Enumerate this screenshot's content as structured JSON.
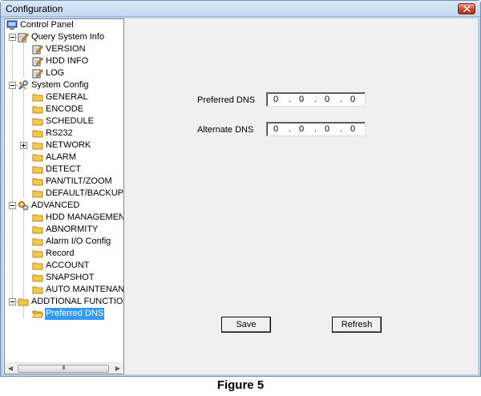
{
  "window": {
    "title": "Configuration"
  },
  "tree": {
    "items": [
      {
        "label": "Control Panel"
      },
      {
        "label": "Query System Info"
      },
      {
        "label": "VERSION"
      },
      {
        "label": "HDD INFO"
      },
      {
        "label": "LOG"
      },
      {
        "label": "System Config"
      },
      {
        "label": "GENERAL"
      },
      {
        "label": "ENCODE"
      },
      {
        "label": "SCHEDULE"
      },
      {
        "label": "RS232"
      },
      {
        "label": "NETWORK"
      },
      {
        "label": "ALARM"
      },
      {
        "label": "DETECT"
      },
      {
        "label": "PAN/TILT/ZOOM"
      },
      {
        "label": "DEFAULT/BACKUP"
      },
      {
        "label": "ADVANCED"
      },
      {
        "label": "HDD MANAGEMENT"
      },
      {
        "label": "ABNORMITY"
      },
      {
        "label": "Alarm I/O Config"
      },
      {
        "label": "Record"
      },
      {
        "label": "ACCOUNT"
      },
      {
        "label": "SNAPSHOT"
      },
      {
        "label": "AUTO MAINTENANCE"
      },
      {
        "label": "ADDTIONAL FUNCTION"
      },
      {
        "label": "Preferred DNS"
      }
    ],
    "scroll_thumb_glyph": "III"
  },
  "form": {
    "preferred_dns": {
      "label": "Preferred DNS",
      "octets": [
        "0",
        "0",
        "0",
        "0"
      ]
    },
    "alternate_dns": {
      "label": "Alternate DNS",
      "octets": [
        "0",
        "0",
        "0",
        "0"
      ]
    },
    "separator": ".",
    "save_label": "Save",
    "refresh_label": "Refresh"
  },
  "caption": "Figure 5",
  "colors": {
    "selection": "#3399ff",
    "folder": "#f5c94a",
    "close_button": "#c7462a"
  }
}
